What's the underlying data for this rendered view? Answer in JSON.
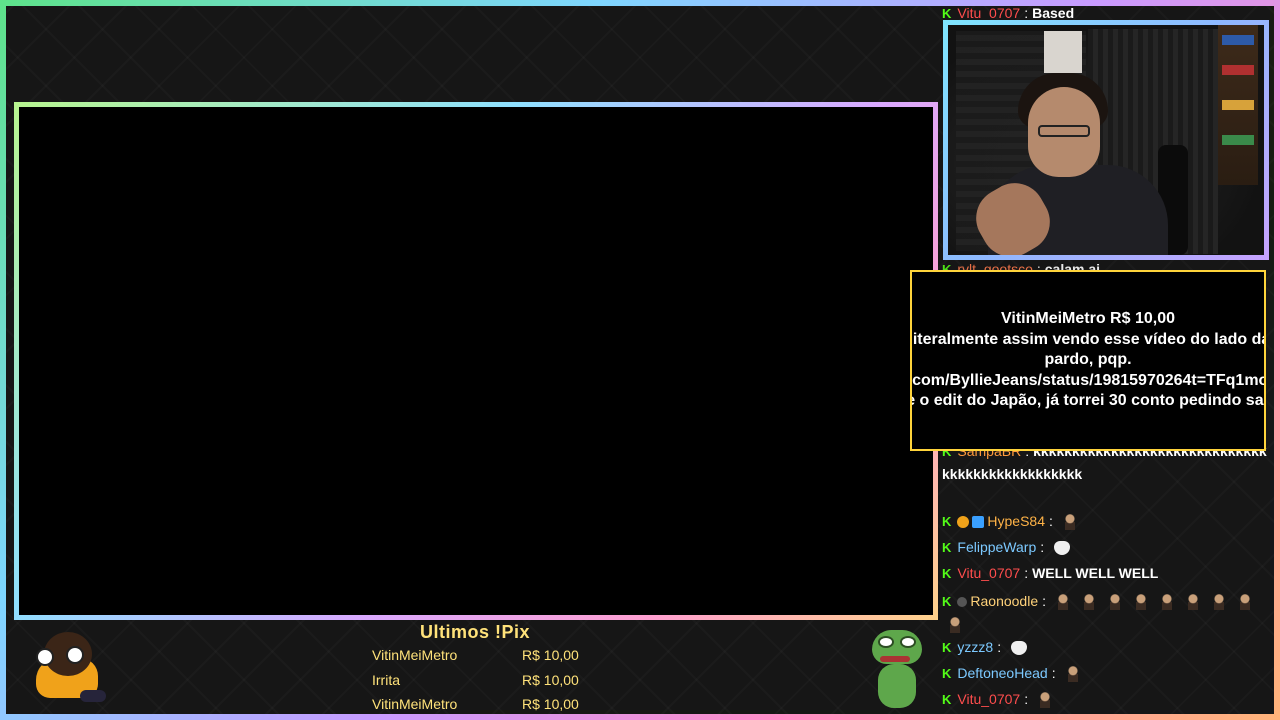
{
  "colors": {
    "kick_green": "#53fc18",
    "alert_border": "#ffd43b",
    "pix_text": "#ffe27a"
  },
  "chat": [
    {
      "user": "Vitu_0707",
      "color": "#ff4d4d",
      "msg": "Based",
      "emotes": 0
    },
    {
      "user": "rvlt_gootsco",
      "color": "#ff7a4d",
      "msg": "calam ai",
      "emotes": 0
    },
    {
      "user": "SampaBR",
      "color": "#ff9a3d",
      "msg": "kkkkkkkkkkkkkkkkkkkkkkkkkkkkkkkkkkkkkkkkkkkkkkkk",
      "emotes": 0
    },
    {
      "user": "HypeS84",
      "color": "#ffb347",
      "msg": "",
      "emotes": 1
    },
    {
      "user": "FelippeWarp",
      "color": "#7cc9ff",
      "msg": "",
      "emotes": 1
    },
    {
      "user": "Vitu_0707",
      "color": "#ff4d4d",
      "msg": "WELL WELL WELL",
      "emotes": 0
    },
    {
      "user": "Raonoodle",
      "color": "#ffd27a",
      "msg": "",
      "emotes": 9
    },
    {
      "user": "yzzz8",
      "color": "#7cc9ff",
      "msg": "",
      "emotes": 1
    },
    {
      "user": "DeftoneoHead",
      "color": "#7cc9ff",
      "msg": "",
      "emotes": 1
    },
    {
      "user": "Vitu_0707",
      "color": "#ff4d4d",
      "msg": "",
      "emotes": 1
    }
  ],
  "alert": {
    "title": "VitinMeiMetro R$ 10,00",
    "message": "Estou literalmente assim vendo esse vídeo do lado da muié, pardo, pqp. https://x.com/ByllieJeans/status/19815970264t=TFq1mozUtHBtk (Poste o edit do Japão, já torrei 30 conto pedindo saporra)"
  },
  "pix": {
    "title": "Ultimos !Pix",
    "rows": [
      {
        "name": "VitinMeiMetro",
        "amount": "R$ 10,00"
      },
      {
        "name": "Irrita",
        "amount": "R$ 10,00"
      },
      {
        "name": "VitinMeiMetro",
        "amount": "R$ 10,00"
      }
    ]
  }
}
